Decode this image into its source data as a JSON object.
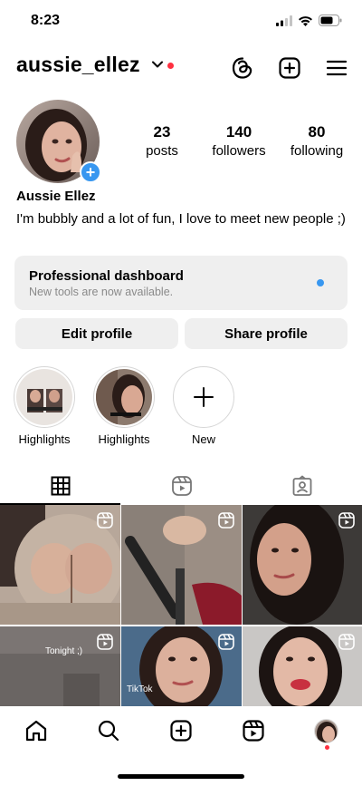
{
  "status_bar": {
    "time": "8:23"
  },
  "header": {
    "username": "aussie_ellez"
  },
  "profile": {
    "stats": [
      {
        "value": "23",
        "label": "posts"
      },
      {
        "value": "140",
        "label": "followers"
      },
      {
        "value": "80",
        "label": "following"
      }
    ],
    "display_name": "Aussie Ellez",
    "bio": "I'm bubbly and a lot of fun, I love to meet new people ;)"
  },
  "dashboard": {
    "title": "Professional dashboard",
    "subtitle": "New tools are now available."
  },
  "buttons": {
    "edit": "Edit profile",
    "share": "Share profile"
  },
  "highlights": [
    {
      "label": "Highlights"
    },
    {
      "label": "Highlights"
    },
    {
      "label": "New"
    }
  ],
  "posts": {
    "captions": {
      "tonight": "Tonight ;)",
      "tiktok": "TikTok"
    }
  },
  "colors": {
    "accent_blue": "#3897f0",
    "notification_red": "#ff3040",
    "card_bg": "#efefef"
  },
  "icons": {
    "header": [
      "threads-icon",
      "create-post-icon",
      "menu-icon"
    ],
    "tabs": [
      "grid-icon",
      "reels-icon",
      "tagged-icon"
    ],
    "nav": [
      "home-icon",
      "search-icon",
      "create-icon",
      "reels-icon",
      "profile-avatar"
    ]
  }
}
